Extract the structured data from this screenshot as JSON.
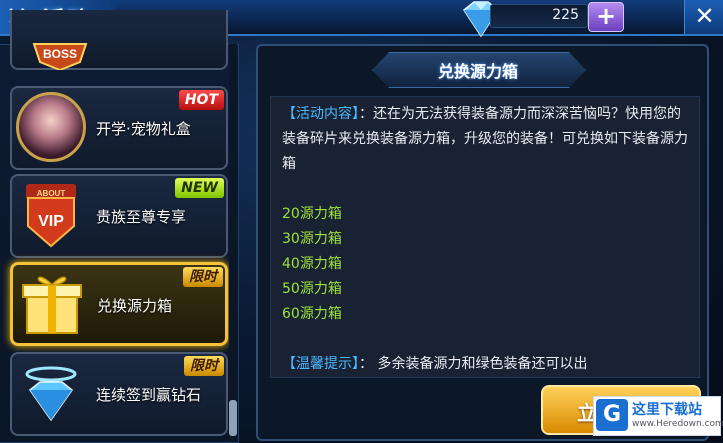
{
  "header": {
    "title": "活动",
    "diamonds": "225",
    "plus_symbol": "+",
    "close_symbol": "✕"
  },
  "activity_list": [
    {
      "label": "",
      "tag": "BOSS"
    },
    {
      "label": "开学·宠物礼盒",
      "tag": "HOT"
    },
    {
      "label": "贵族至尊专享",
      "tag": "NEW",
      "icon_text": "VIP",
      "icon_subtext": "ABOUT"
    },
    {
      "label": "兑换源力箱",
      "tag": "限时",
      "selected": true
    },
    {
      "label": "连续签到赢钻石",
      "tag": "限时"
    }
  ],
  "detail": {
    "title": "兑换源力箱",
    "content_heading": "【活动内容】",
    "content_text": "：还在为无法获得装备源力而深深苦恼吗？快用您的装备碎片来兑换装备源力箱，升级您的装备！可兑换如下装备源力箱",
    "rewards": [
      "20源力箱",
      "30源力箱",
      "40源力箱",
      "50源力箱",
      "60源力箱"
    ],
    "tip_heading": "【温馨提示】",
    "tip_text": "：  多余装备源力和绿色装备还可以出"
  },
  "claim_button": {
    "label": "立"
  },
  "watermark": {
    "title": "这里下载站",
    "url": "www.Heredown.com"
  }
}
